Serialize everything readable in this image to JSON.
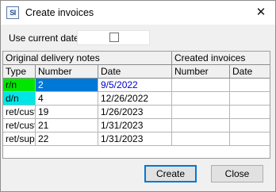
{
  "window": {
    "title": "Create invoices",
    "icon_text": "SI"
  },
  "options": {
    "use_current_date_label": "Use current date",
    "use_current_date_checked": false
  },
  "grid": {
    "group_headers": [
      "Original delivery notes",
      "Created invoices"
    ],
    "columns": [
      "Type",
      "Number",
      "Date",
      "Number",
      "Date"
    ],
    "rows": [
      {
        "type": "r/n",
        "number": "2",
        "date": "9/5/2022",
        "inv_number": "",
        "inv_date": ""
      },
      {
        "type": "d/n",
        "number": "4",
        "date": "12/26/2022",
        "inv_number": "",
        "inv_date": ""
      },
      {
        "type": "ret/cust",
        "number": "19",
        "date": "1/26/2023",
        "inv_number": "",
        "inv_date": ""
      },
      {
        "type": "ret/cust",
        "number": "21",
        "date": "1/31/2023",
        "inv_number": "",
        "inv_date": ""
      },
      {
        "type": "ret/supp",
        "number": "22",
        "date": "1/31/2023",
        "inv_number": "",
        "inv_date": ""
      }
    ]
  },
  "buttons": {
    "create": "Create",
    "close": "Close"
  },
  "colors": {
    "rn_type": "#00e600",
    "dn_type": "#00e6e6",
    "selected": "#0078d7",
    "selected_date_text": "#0000cc"
  }
}
